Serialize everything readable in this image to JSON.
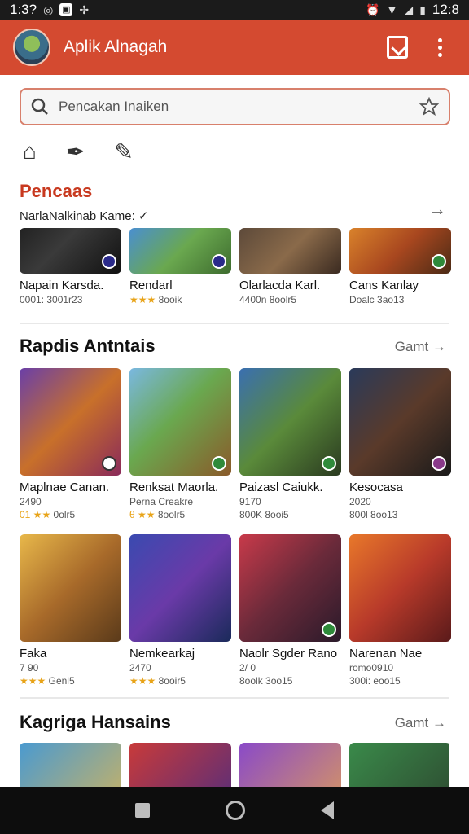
{
  "status": {
    "time_left": "1:3?",
    "time_right": "12:8"
  },
  "app": {
    "title": "Aplik Alnagah"
  },
  "search": {
    "placeholder": "Pencakan Inaiken"
  },
  "section1": {
    "title": "Pencaas",
    "subtitle": "NarlaNalkinab Kame:",
    "items": [
      {
        "title": "Napain Karsda.",
        "meta": "0001: 3001r23"
      },
      {
        "title": "Rendarl",
        "meta": "8ooik"
      },
      {
        "title": "Olarlacda Karl.",
        "meta": "4400n 8oolr5"
      },
      {
        "title": "Cans Kanlay",
        "meta": "Doalc 3ao13"
      }
    ]
  },
  "section2": {
    "title": "Rapdis Antntais",
    "link": "Gamt",
    "row1": [
      {
        "title": "Maplnae Canan.",
        "sub": "2490",
        "meta": "0olr5"
      },
      {
        "title": "Renksat Maorla.",
        "sub": "Perna Creakre",
        "meta": "8oolr5"
      },
      {
        "title": "Paizasl Caiukk.",
        "sub": "9170",
        "meta": "800K 8ooi5"
      },
      {
        "title": "Kesocasa",
        "sub": "2020",
        "meta": "800l 8oo13"
      }
    ],
    "row2": [
      {
        "title": "Faka",
        "sub": "7 90",
        "meta": "Genl5"
      },
      {
        "title": "Nemkearkaj",
        "sub": "2470",
        "meta": "8ooir5"
      },
      {
        "title": "Naolr Sgder Rano",
        "sub": "2/ 0",
        "meta": "8oolk 3oo15"
      },
      {
        "title": "Narenan Nae",
        "sub": "romo0910",
        "meta": "300i: eoo15"
      }
    ]
  },
  "section3": {
    "title": "Kagriga Hansains",
    "link": "Gamt"
  },
  "colors": {
    "accent": "#d44a30",
    "star": "#e8a317"
  }
}
